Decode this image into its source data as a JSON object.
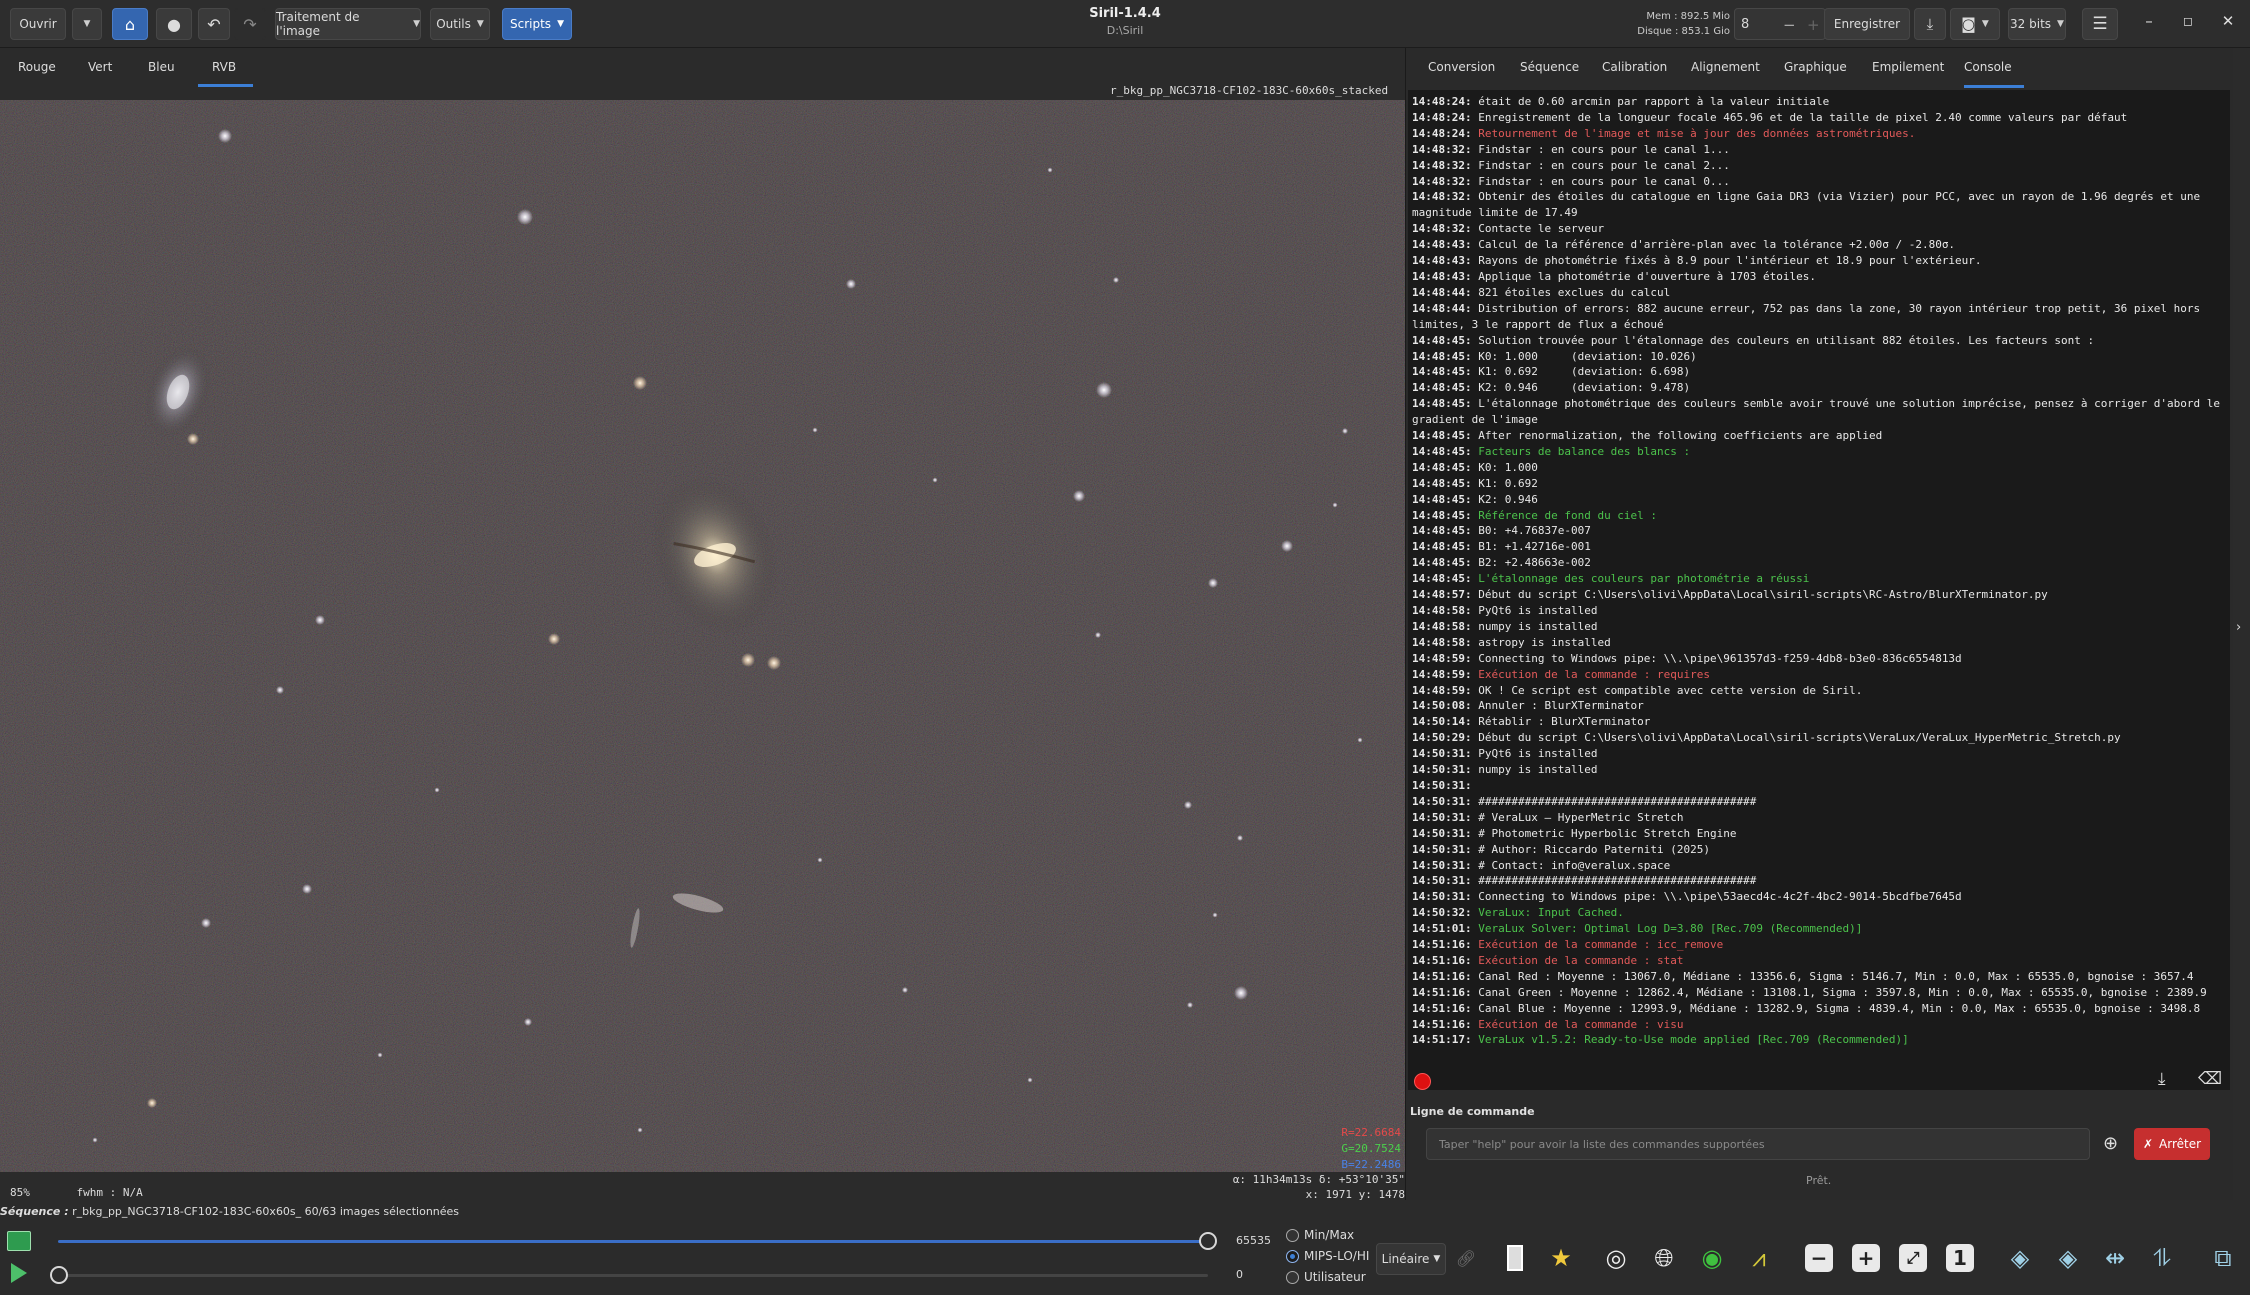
{
  "header": {
    "open_label": "Ouvrir",
    "image_processing_label": "Traitement de l'image",
    "tools_label": "Outils",
    "scripts_label": "Scripts",
    "app_title": "Siril-1.4.4",
    "app_path": "D:\\Siril",
    "memory": "Mem : 892.5 Mio",
    "disk": "Disque : 853.1 Gio",
    "threads": "8",
    "save_label": "Enregistrer",
    "bit_depth": "32 bits"
  },
  "viewer": {
    "channel_tabs": [
      "Rouge",
      "Vert",
      "Bleu",
      "RVB"
    ],
    "active_tab": "RVB",
    "filename": "r_bkg_pp_NGC3718-CF102-183C-60x60s_stacked",
    "pixel_r": "R=22.6684",
    "pixel_g": "G=20.7524",
    "pixel_b": "B=22.2486",
    "zoom": "85%",
    "fwhm": "fwhm : N/A",
    "coords_radec": "α: 11h34m13s δ: +53°10'35\"",
    "coords_xy": "x: 1971 y: 1478"
  },
  "panel": {
    "tabs": [
      "Conversion",
      "Séquence",
      "Calibration",
      "Alignement",
      "Graphique",
      "Empilement",
      "Console"
    ],
    "active_tab": "Console",
    "command_label": "Ligne de commande",
    "command_placeholder": "Taper \"help\" pour avoir la liste des commandes supportées",
    "stop_label": "Arrêter",
    "ready": "Prêt."
  },
  "console_lines": [
    {
      "t": "14:48:24:",
      "m": "était de 0.60 arcmin par rapport à la valeur initiale",
      "c": ""
    },
    {
      "t": "14:48:24:",
      "m": "Enregistrement de la longueur focale 465.96 et de la taille de pixel 2.40 comme valeurs par défaut",
      "c": ""
    },
    {
      "t": "14:48:24:",
      "m": "Retournement de l'image et mise à jour des données astrométriques.",
      "c": "red"
    },
    {
      "t": "14:48:32:",
      "m": "Findstar : en cours pour le canal 1...",
      "c": ""
    },
    {
      "t": "14:48:32:",
      "m": "Findstar : en cours pour le canal 2...",
      "c": ""
    },
    {
      "t": "14:48:32:",
      "m": "Findstar : en cours pour le canal 0...",
      "c": ""
    },
    {
      "t": "14:48:32:",
      "m": "Obtenir des étoiles du catalogue en ligne Gaia DR3 (via Vizier) pour PCC, avec un rayon de 1.96 degrés et une magnitude limite de 17.49",
      "c": ""
    },
    {
      "t": "14:48:32:",
      "m": "Contacte le serveur",
      "c": ""
    },
    {
      "t": "14:48:43:",
      "m": "Calcul de la référence d'arrière-plan avec la tolérance +2.00σ / -2.80σ.",
      "c": ""
    },
    {
      "t": "14:48:43:",
      "m": "Rayons de photométrie fixés à 8.9 pour l'intérieur et 18.9 pour l'extérieur.",
      "c": ""
    },
    {
      "t": "14:48:43:",
      "m": "Applique la photométrie d'ouverture à 1703 étoiles.",
      "c": ""
    },
    {
      "t": "14:48:44:",
      "m": "821 étoiles exclues du calcul",
      "c": ""
    },
    {
      "t": "14:48:44:",
      "m": "Distribution of errors: 882 aucune erreur, 752 pas dans la zone, 30 rayon intérieur trop petit, 36 pixel hors limites, 3 le rapport de flux a échoué",
      "c": ""
    },
    {
      "t": "14:48:45:",
      "m": "Solution trouvée pour l'étalonnage des couleurs en utilisant 882 étoiles. Les facteurs sont :",
      "c": ""
    },
    {
      "t": "14:48:45:",
      "m": "K0: 1.000     (deviation: 10.026)",
      "c": ""
    },
    {
      "t": "14:48:45:",
      "m": "K1: 0.692     (deviation: 6.698)",
      "c": ""
    },
    {
      "t": "14:48:45:",
      "m": "K2: 0.946     (deviation: 9.478)",
      "c": ""
    },
    {
      "t": "14:48:45:",
      "m": "L'étalonnage photométrique des couleurs semble avoir trouvé une solution imprécise, pensez à corriger d'abord le gradient de l'image",
      "c": ""
    },
    {
      "t": "14:48:45:",
      "m": "After renormalization, the following coefficients are applied",
      "c": ""
    },
    {
      "t": "14:48:45:",
      "m": "Facteurs de balance des blancs :",
      "c": "green"
    },
    {
      "t": "14:48:45:",
      "m": "K0: 1.000",
      "c": ""
    },
    {
      "t": "14:48:45:",
      "m": "K1: 0.692",
      "c": ""
    },
    {
      "t": "14:48:45:",
      "m": "K2: 0.946",
      "c": ""
    },
    {
      "t": "14:48:45:",
      "m": "Référence de fond du ciel :",
      "c": "green"
    },
    {
      "t": "14:48:45:",
      "m": "B0: +4.76837e-007",
      "c": ""
    },
    {
      "t": "14:48:45:",
      "m": "B1: +1.42716e-001",
      "c": ""
    },
    {
      "t": "14:48:45:",
      "m": "B2: +2.48663e-002",
      "c": ""
    },
    {
      "t": "14:48:45:",
      "m": "L'étalonnage des couleurs par photométrie a réussi",
      "c": "green"
    },
    {
      "t": "14:48:57:",
      "m": "Début du script C:\\Users\\olivi\\AppData\\Local\\siril-scripts\\RC-Astro/BlurXTerminator.py",
      "c": ""
    },
    {
      "t": "14:48:58:",
      "m": "PyQt6 is installed",
      "c": ""
    },
    {
      "t": "14:48:58:",
      "m": "numpy is installed",
      "c": ""
    },
    {
      "t": "14:48:58:",
      "m": "astropy is installed",
      "c": ""
    },
    {
      "t": "14:48:59:",
      "m": "Connecting to Windows pipe: \\\\.\\pipe\\961357d3-f259-4db8-b3e0-836c6554813d",
      "c": ""
    },
    {
      "t": "14:48:59:",
      "m": "Exécution de la commande : requires",
      "c": "red"
    },
    {
      "t": "14:48:59:",
      "m": "OK ! Ce script est compatible avec cette version de Siril.",
      "c": ""
    },
    {
      "t": "14:50:08:",
      "m": "Annuler : BlurXTerminator",
      "c": ""
    },
    {
      "t": "14:50:14:",
      "m": "Rétablir : BlurXTerminator",
      "c": ""
    },
    {
      "t": "14:50:29:",
      "m": "Début du script C:\\Users\\olivi\\AppData\\Local\\siril-scripts\\VeraLux/VeraLux_HyperMetric_Stretch.py",
      "c": ""
    },
    {
      "t": "14:50:31:",
      "m": "PyQt6 is installed",
      "c": ""
    },
    {
      "t": "14:50:31:",
      "m": "numpy is installed",
      "c": ""
    },
    {
      "t": "14:50:31:",
      "m": "",
      "c": ""
    },
    {
      "t": "14:50:31:",
      "m": "##########################################",
      "c": ""
    },
    {
      "t": "14:50:31:",
      "m": "# VeraLux — HyperMetric Stretch",
      "c": ""
    },
    {
      "t": "14:50:31:",
      "m": "# Photometric Hyperbolic Stretch Engine",
      "c": ""
    },
    {
      "t": "14:50:31:",
      "m": "# Author: Riccardo Paterniti (2025)",
      "c": ""
    },
    {
      "t": "14:50:31:",
      "m": "# Contact: info@veralux.space",
      "c": ""
    },
    {
      "t": "14:50:31:",
      "m": "##########################################",
      "c": ""
    },
    {
      "t": "14:50:31:",
      "m": "Connecting to Windows pipe: \\\\.\\pipe\\53aecd4c-4c2f-4bc2-9014-5bcdfbe7645d",
      "c": ""
    },
    {
      "t": "14:50:32:",
      "m": "VeraLux: Input Cached.",
      "c": "green"
    },
    {
      "t": "14:51:01:",
      "m": "VeraLux Solver: Optimal Log D=3.80 [Rec.709 (Recommended)]",
      "c": "green"
    },
    {
      "t": "14:51:16:",
      "m": "Exécution de la commande : icc_remove",
      "c": "red"
    },
    {
      "t": "14:51:16:",
      "m": "Exécution de la commande : stat",
      "c": "red"
    },
    {
      "t": "14:51:16:",
      "m": "Canal Red : Moyenne : 13067.0, Médiane : 13356.6, Sigma : 5146.7, Min : 0.0, Max : 65535.0, bgnoise : 3657.4",
      "c": ""
    },
    {
      "t": "14:51:16:",
      "m": "Canal Green : Moyenne : 12862.4, Médiane : 13108.1, Sigma : 3597.8, Min : 0.0, Max : 65535.0, bgnoise : 2389.9",
      "c": ""
    },
    {
      "t": "14:51:16:",
      "m": "Canal Blue : Moyenne : 12993.9, Médiane : 13282.9, Sigma : 4839.4, Min : 0.0, Max : 65535.0, bgnoise : 3498.8",
      "c": ""
    },
    {
      "t": "14:51:16:",
      "m": "Exécution de la commande : visu",
      "c": "red"
    },
    {
      "t": "14:51:17:",
      "m": "VeraLux v1.5.2: Ready-to-Use mode applied [Rec.709 (Recommended)]",
      "c": "green"
    }
  ],
  "sequence": {
    "label": "Séquence :",
    "text": "r_bkg_pp_NGC3718-CF102-183C-60x60s_  60/63 images sélectionnées"
  },
  "display": {
    "high_value": "65535",
    "low_value": "0",
    "options": [
      "Min/Max",
      "MIPS-LO/HI",
      "Utilisateur"
    ],
    "selected_option": "MIPS-LO/HI",
    "stretch_mode": "Linéaire"
  },
  "colors": {
    "accent": "#3c7fd6",
    "error_red": "#e35a5a",
    "success_green": "#4cc24c",
    "stop_button": "#c62f2f"
  }
}
